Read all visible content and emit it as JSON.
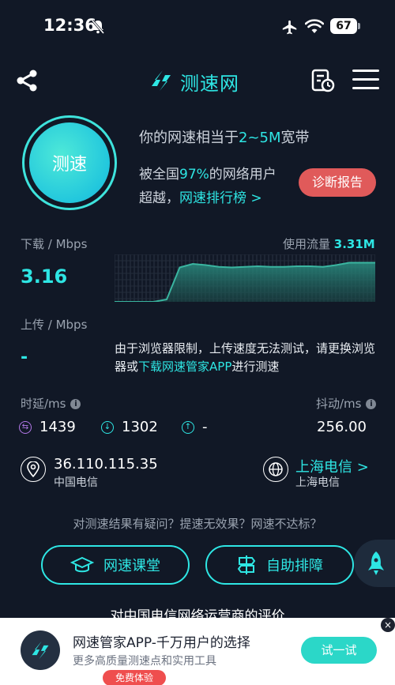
{
  "status_bar": {
    "time": "12:36",
    "battery": "67"
  },
  "header": {
    "brand": "测速网"
  },
  "speed_button": {
    "label": "测速"
  },
  "summary": {
    "line1_prefix": "你的网速相当于",
    "line1_value": "2~5M",
    "line1_suffix": "宽带",
    "line2_prefix": "被全国",
    "line2_value": "97%",
    "line2_suffix": "的网络用户",
    "line3_prefix": "超越，",
    "line3_link": "网速排行榜 >",
    "report_button": "诊断报告"
  },
  "download": {
    "label": "下载 / Mbps",
    "value": "3.16"
  },
  "usage": {
    "label": "使用流量",
    "value": "3.31M"
  },
  "upload": {
    "label": "上传 / Mbps",
    "value": "-",
    "note_part1": "由于浏览器限制，上传速度无法测试，请更换浏览器或",
    "note_link": "下载网速管家APP",
    "note_part2": "进行测速"
  },
  "latency": {
    "label": "时延/ms",
    "info_icon": "i",
    "metrics": [
      {
        "icon": "swap-icon",
        "value": "1439"
      },
      {
        "icon": "arrow-down-circle-icon",
        "value": "1302"
      },
      {
        "icon": "arrow-up-circle-icon",
        "value": "-"
      }
    ]
  },
  "jitter": {
    "label": "抖动/ms",
    "value": "256.00"
  },
  "network": {
    "ip": "36.110.115.35",
    "isp_left": "中国电信",
    "isp_link": "上海电信 >",
    "isp_right": "上海电信"
  },
  "feedback": {
    "question": "对测速结果有疑问？提速无效果？网速不达标？",
    "course_button": "网速课堂",
    "troubleshoot_button": "自助排障"
  },
  "evaluation_title": "对中国电信网络运营商的评价",
  "ad": {
    "close": "×",
    "title": "网速管家APP-千万用户的选择",
    "subtitle": "更多高质量测速点和实用工具",
    "button": "试一试",
    "badge": "免费体验"
  },
  "colors": {
    "accent": "#2ee6e4",
    "background": "#111826",
    "report": "#e05a5a"
  },
  "chart_data": {
    "type": "area",
    "x": [
      0,
      1,
      2,
      3,
      4,
      5,
      6,
      7,
      8,
      9,
      10,
      11,
      12,
      13,
      14,
      15,
      16,
      17,
      18,
      19,
      20
    ],
    "values": [
      0,
      0,
      0,
      0,
      0.2,
      2.9,
      3.2,
      3.1,
      2.95,
      2.9,
      2.95,
      3.0,
      2.95,
      2.95,
      3.0,
      3.0,
      2.95,
      3.1,
      3.3,
      3.3,
      3.3
    ],
    "ylim": [
      0,
      4
    ],
    "grid": true
  }
}
